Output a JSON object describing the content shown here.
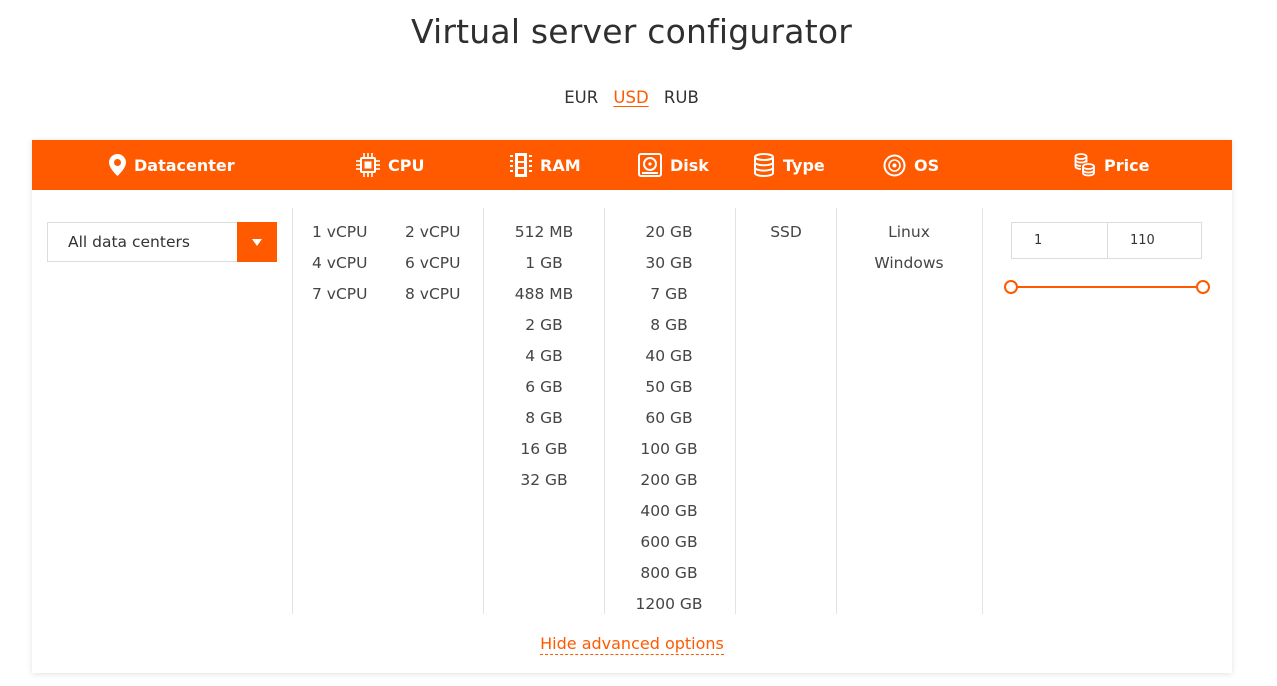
{
  "title": "Virtual server configurator",
  "currencies": [
    {
      "label": "EUR",
      "active": false
    },
    {
      "label": "USD",
      "active": true
    },
    {
      "label": "RUB",
      "active": false
    }
  ],
  "colors": {
    "accent": "#ff5a00",
    "header_text": "#ffffff",
    "divider": "#e3e3e3"
  },
  "header": {
    "datacenter": "Datacenter",
    "cpu": "CPU",
    "ram": "RAM",
    "disk": "Disk",
    "type": "Type",
    "os": "OS",
    "price": "Price"
  },
  "icons": {
    "datacenter": "map-pin-icon",
    "cpu": "cpu-chip-icon",
    "ram": "ram-module-icon",
    "disk": "disk-drive-icon",
    "type": "database-icon",
    "os": "os-disc-icon",
    "price": "coins-icon",
    "select": "caret-down-icon"
  },
  "datacenter": {
    "selected": "All data centers"
  },
  "cpu": [
    "1 vCPU",
    "2 vCPU",
    "4 vCPU",
    "6 vCPU",
    "7 vCPU",
    "8 vCPU"
  ],
  "ram": [
    "512 MB",
    "1 GB",
    "488 MB",
    "2 GB",
    "4 GB",
    "6 GB",
    "8 GB",
    "16 GB",
    "32 GB"
  ],
  "disk": [
    "20 GB",
    "30 GB",
    "7 GB",
    "8 GB",
    "40 GB",
    "50 GB",
    "60 GB",
    "100 GB",
    "200 GB",
    "400 GB",
    "600 GB",
    "800 GB",
    "1200 GB"
  ],
  "type": [
    "SSD"
  ],
  "os": [
    "Linux",
    "Windows"
  ],
  "price": {
    "min": "1",
    "max": "110",
    "range_from": 1,
    "range_to": 110
  },
  "advanced_link": "Hide advanced options"
}
